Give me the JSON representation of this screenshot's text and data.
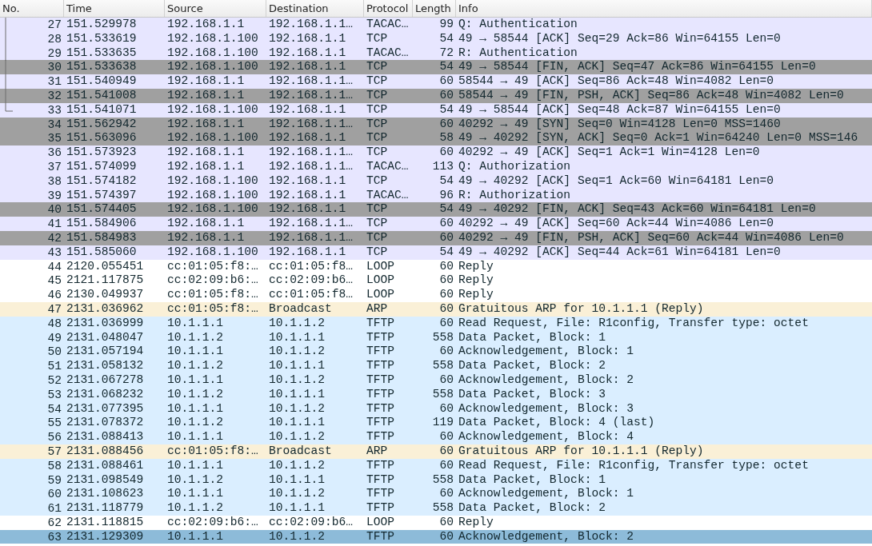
{
  "columns": [
    "No.",
    "Time",
    "Source",
    "Destination",
    "Protocol",
    "Length",
    "Info"
  ],
  "rows": [
    {
      "no": "27",
      "time": "151.529978",
      "source": "192.168.1.1",
      "destination": "192.168.1.1…",
      "protocol": "TACAC…",
      "length": "99",
      "info": "Q: Authentication",
      "kind": "tcp",
      "selected": false,
      "in_conversation": true
    },
    {
      "no": "28",
      "time": "151.533619",
      "source": "192.168.1.100",
      "destination": "192.168.1.1",
      "protocol": "TCP",
      "length": "54",
      "info": "49 → 58544 [ACK] Seq=29 Ack=86 Win=64155 Len=0",
      "kind": "tcp",
      "selected": false,
      "in_conversation": true
    },
    {
      "no": "29",
      "time": "151.533635",
      "source": "192.168.1.100",
      "destination": "192.168.1.1",
      "protocol": "TACAC…",
      "length": "72",
      "info": "R: Authentication",
      "kind": "tcp",
      "selected": false,
      "in_conversation": true
    },
    {
      "no": "30",
      "time": "151.533638",
      "source": "192.168.1.100",
      "destination": "192.168.1.1",
      "protocol": "TCP",
      "length": "54",
      "info": "49 → 58544 [FIN, ACK] Seq=47 Ack=86 Win=64155 Len=0",
      "kind": "flag",
      "selected": false,
      "in_conversation": true
    },
    {
      "no": "31",
      "time": "151.540949",
      "source": "192.168.1.1",
      "destination": "192.168.1.1…",
      "protocol": "TCP",
      "length": "60",
      "info": "58544 → 49 [ACK] Seq=86 Ack=48 Win=4082 Len=0",
      "kind": "tcp",
      "selected": false,
      "in_conversation": true
    },
    {
      "no": "32",
      "time": "151.541008",
      "source": "192.168.1.1",
      "destination": "192.168.1.1…",
      "protocol": "TCP",
      "length": "60",
      "info": "58544 → 49 [FIN, PSH, ACK] Seq=86 Ack=48 Win=4082 Len=0",
      "kind": "flag",
      "selected": false,
      "in_conversation": true
    },
    {
      "no": "33",
      "time": "151.541071",
      "source": "192.168.1.100",
      "destination": "192.168.1.1",
      "protocol": "TCP",
      "length": "54",
      "info": "49 → 58544 [ACK] Seq=48 Ack=87 Win=64155 Len=0",
      "kind": "tcp",
      "selected": false,
      "in_conversation": true,
      "conversation_end": true
    },
    {
      "no": "34",
      "time": "151.562942",
      "source": "192.168.1.1",
      "destination": "192.168.1.1…",
      "protocol": "TCP",
      "length": "60",
      "info": "40292 → 49 [SYN] Seq=0 Win=4128 Len=0 MSS=1460",
      "kind": "flag",
      "selected": false
    },
    {
      "no": "35",
      "time": "151.563096",
      "source": "192.168.1.100",
      "destination": "192.168.1.1",
      "protocol": "TCP",
      "length": "58",
      "info": "49 → 40292 [SYN, ACK] Seq=0 Ack=1 Win=64240 Len=0 MSS=146",
      "kind": "flag",
      "selected": false
    },
    {
      "no": "36",
      "time": "151.573923",
      "source": "192.168.1.1",
      "destination": "192.168.1.1…",
      "protocol": "TCP",
      "length": "60",
      "info": "40292 → 49 [ACK] Seq=1 Ack=1 Win=4128 Len=0",
      "kind": "tcp",
      "selected": false
    },
    {
      "no": "37",
      "time": "151.574099",
      "source": "192.168.1.1",
      "destination": "192.168.1.1…",
      "protocol": "TACAC…",
      "length": "113",
      "info": "Q: Authorization",
      "kind": "tcp",
      "selected": false
    },
    {
      "no": "38",
      "time": "151.574182",
      "source": "192.168.1.100",
      "destination": "192.168.1.1",
      "protocol": "TCP",
      "length": "54",
      "info": "49 → 40292 [ACK] Seq=1 Ack=60 Win=64181 Len=0",
      "kind": "tcp",
      "selected": false
    },
    {
      "no": "39",
      "time": "151.574397",
      "source": "192.168.1.100",
      "destination": "192.168.1.1",
      "protocol": "TACAC…",
      "length": "96",
      "info": "R: Authorization",
      "kind": "tcp",
      "selected": false
    },
    {
      "no": "40",
      "time": "151.574405",
      "source": "192.168.1.100",
      "destination": "192.168.1.1",
      "protocol": "TCP",
      "length": "54",
      "info": "49 → 40292 [FIN, ACK] Seq=43 Ack=60 Win=64181 Len=0",
      "kind": "flag",
      "selected": false
    },
    {
      "no": "41",
      "time": "151.584906",
      "source": "192.168.1.1",
      "destination": "192.168.1.1…",
      "protocol": "TCP",
      "length": "60",
      "info": "40292 → 49 [ACK] Seq=60 Ack=44 Win=4086 Len=0",
      "kind": "tcp",
      "selected": false
    },
    {
      "no": "42",
      "time": "151.584983",
      "source": "192.168.1.1",
      "destination": "192.168.1.1…",
      "protocol": "TCP",
      "length": "60",
      "info": "40292 → 49 [FIN, PSH, ACK] Seq=60 Ack=44 Win=4086 Len=0",
      "kind": "flag",
      "selected": false
    },
    {
      "no": "43",
      "time": "151.585060",
      "source": "192.168.1.100",
      "destination": "192.168.1.1",
      "protocol": "TCP",
      "length": "54",
      "info": "49 → 40292 [ACK] Seq=44 Ack=61 Win=64181 Len=0",
      "kind": "tcp",
      "selected": false
    },
    {
      "no": "44",
      "time": "2120.055451",
      "source": "cc:01:05:f8:…",
      "destination": "cc:01:05:f8…",
      "protocol": "LOOP",
      "length": "60",
      "info": "Reply",
      "kind": "loop",
      "selected": false
    },
    {
      "no": "45",
      "time": "2121.117875",
      "source": "cc:02:09:b6:…",
      "destination": "cc:02:09:b6…",
      "protocol": "LOOP",
      "length": "60",
      "info": "Reply",
      "kind": "loop",
      "selected": false
    },
    {
      "no": "46",
      "time": "2130.049937",
      "source": "cc:01:05:f8:…",
      "destination": "cc:01:05:f8…",
      "protocol": "LOOP",
      "length": "60",
      "info": "Reply",
      "kind": "loop",
      "selected": false
    },
    {
      "no": "47",
      "time": "2131.036962",
      "source": "cc:01:05:f8:…",
      "destination": "Broadcast",
      "protocol": "ARP",
      "length": "60",
      "info": "Gratuitous ARP for 10.1.1.1 (Reply)",
      "kind": "arp",
      "selected": false
    },
    {
      "no": "48",
      "time": "2131.036999",
      "source": "10.1.1.1",
      "destination": "10.1.1.2",
      "protocol": "TFTP",
      "length": "60",
      "info": "Read Request, File: R1config, Transfer type: octet",
      "kind": "udp",
      "selected": false
    },
    {
      "no": "49",
      "time": "2131.048047",
      "source": "10.1.1.2",
      "destination": "10.1.1.1",
      "protocol": "TFTP",
      "length": "558",
      "info": "Data Packet, Block: 1",
      "kind": "udp",
      "selected": false
    },
    {
      "no": "50",
      "time": "2131.057194",
      "source": "10.1.1.1",
      "destination": "10.1.1.2",
      "protocol": "TFTP",
      "length": "60",
      "info": "Acknowledgement, Block: 1",
      "kind": "udp",
      "selected": false
    },
    {
      "no": "51",
      "time": "2131.058132",
      "source": "10.1.1.2",
      "destination": "10.1.1.1",
      "protocol": "TFTP",
      "length": "558",
      "info": "Data Packet, Block: 2",
      "kind": "udp",
      "selected": false
    },
    {
      "no": "52",
      "time": "2131.067278",
      "source": "10.1.1.1",
      "destination": "10.1.1.2",
      "protocol": "TFTP",
      "length": "60",
      "info": "Acknowledgement, Block: 2",
      "kind": "udp",
      "selected": false
    },
    {
      "no": "53",
      "time": "2131.068232",
      "source": "10.1.1.2",
      "destination": "10.1.1.1",
      "protocol": "TFTP",
      "length": "558",
      "info": "Data Packet, Block: 3",
      "kind": "udp",
      "selected": false
    },
    {
      "no": "54",
      "time": "2131.077395",
      "source": "10.1.1.1",
      "destination": "10.1.1.2",
      "protocol": "TFTP",
      "length": "60",
      "info": "Acknowledgement, Block: 3",
      "kind": "udp",
      "selected": false
    },
    {
      "no": "55",
      "time": "2131.078372",
      "source": "10.1.1.2",
      "destination": "10.1.1.1",
      "protocol": "TFTP",
      "length": "119",
      "info": "Data Packet, Block: 4 (last)",
      "kind": "udp",
      "selected": false
    },
    {
      "no": "56",
      "time": "2131.088413",
      "source": "10.1.1.1",
      "destination": "10.1.1.2",
      "protocol": "TFTP",
      "length": "60",
      "info": "Acknowledgement, Block: 4",
      "kind": "udp",
      "selected": false
    },
    {
      "no": "57",
      "time": "2131.088456",
      "source": "cc:01:05:f8:…",
      "destination": "Broadcast",
      "protocol": "ARP",
      "length": "60",
      "info": "Gratuitous ARP for 10.1.1.1 (Reply)",
      "kind": "arp",
      "selected": false
    },
    {
      "no": "58",
      "time": "2131.088461",
      "source": "10.1.1.1",
      "destination": "10.1.1.2",
      "protocol": "TFTP",
      "length": "60",
      "info": "Read Request, File: R1config, Transfer type: octet",
      "kind": "udp",
      "selected": false
    },
    {
      "no": "59",
      "time": "2131.098549",
      "source": "10.1.1.2",
      "destination": "10.1.1.1",
      "protocol": "TFTP",
      "length": "558",
      "info": "Data Packet, Block: 1",
      "kind": "udp",
      "selected": false
    },
    {
      "no": "60",
      "time": "2131.108623",
      "source": "10.1.1.1",
      "destination": "10.1.1.2",
      "protocol": "TFTP",
      "length": "60",
      "info": "Acknowledgement, Block: 1",
      "kind": "udp",
      "selected": false
    },
    {
      "no": "61",
      "time": "2131.118779",
      "source": "10.1.1.2",
      "destination": "10.1.1.1",
      "protocol": "TFTP",
      "length": "558",
      "info": "Data Packet, Block: 2",
      "kind": "udp",
      "selected": false
    },
    {
      "no": "62",
      "time": "2131.118815",
      "source": "cc:02:09:b6:…",
      "destination": "cc:02:09:b6…",
      "protocol": "LOOP",
      "length": "60",
      "info": "Reply",
      "kind": "loop",
      "selected": false
    },
    {
      "no": "63",
      "time": "2131.129309",
      "source": "10.1.1.1",
      "destination": "10.1.1.2",
      "protocol": "TFTP",
      "length": "60",
      "info": "Acknowledgement, Block: 2",
      "kind": "udp",
      "selected": true
    }
  ]
}
